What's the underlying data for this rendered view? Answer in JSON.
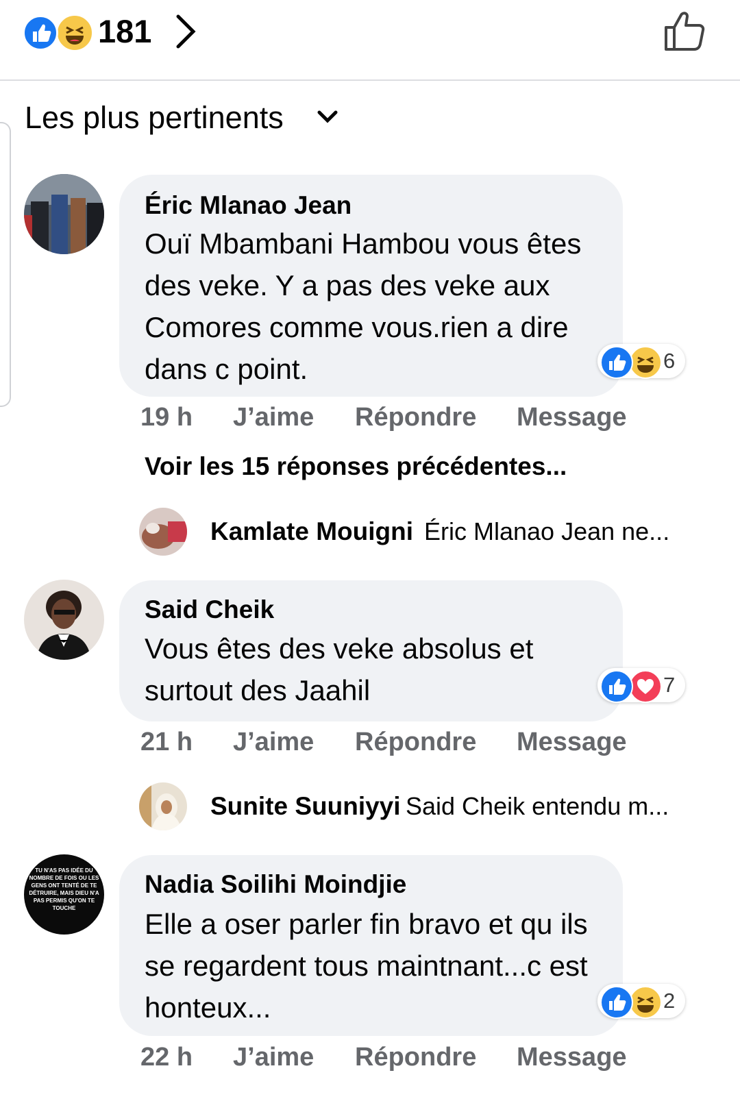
{
  "header": {
    "reaction_icons": [
      "like-icon",
      "haha-icon"
    ],
    "reaction_count": "181",
    "like_button_icon": "thumbs-up-outline-icon"
  },
  "sort": {
    "label": "Les plus pertinents",
    "icon": "chevron-down-icon"
  },
  "colors": {
    "like_blue": "#1877f2",
    "haha_yellow": "#f7c84a",
    "love_red": "#f33e58",
    "bubble_bg": "#f0f2f5",
    "meta_gray": "#65676b"
  },
  "comments": [
    {
      "author": "Éric Mlanao Jean",
      "text": "Ouï Mbambani Hambou vous êtes des veke. Y a pas des veke aux Comores comme vous.rien a dire dans c point.",
      "reactions": {
        "icons": [
          "like-icon",
          "haha-icon"
        ],
        "count": "6"
      },
      "time": "19 h",
      "like_label": "J’aime",
      "reply_label": "Répondre",
      "message_label": "Message",
      "view_previous": "Voir les 15 réponses précédentes...",
      "reply": {
        "author": "Kamlate Mouigni",
        "preview": "Éric Mlanao Jean ne..."
      }
    },
    {
      "author": "Said Cheik",
      "text": "Vous êtes des veke absolus et surtout des Jaahil",
      "reactions": {
        "icons": [
          "like-icon",
          "love-icon"
        ],
        "count": "7"
      },
      "time": "21 h",
      "like_label": "J’aime",
      "reply_label": "Répondre",
      "message_label": "Message",
      "reply": {
        "author": "Sunite Suuniyyi",
        "preview": "Said Cheik entendu m..."
      }
    },
    {
      "author": "Nadia Soilihi Moindjie",
      "avatar_text": "TU N'AS PAS IDÉE DU NOMBRE DE FOIS OU LES GENS ONT TENTÉ DE TE DÉTRUIRE, MAIS DIEU N'A PAS PERMIS QU'ON TE TOUCHE",
      "text": "Elle a oser parler fin bravo et qu ils se regardent tous maintnant...c est honteux...",
      "reactions": {
        "icons": [
          "like-icon",
          "haha-icon"
        ],
        "count": "2"
      },
      "time": "22 h",
      "like_label": "J’aime",
      "reply_label": "Répondre",
      "message_label": "Message"
    }
  ]
}
